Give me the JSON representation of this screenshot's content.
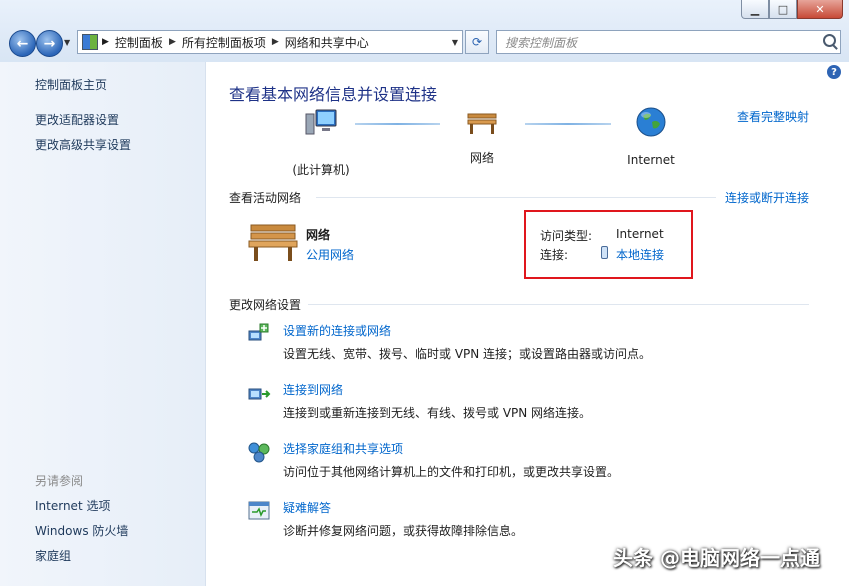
{
  "window": {
    "min_icon": "minimize-icon",
    "max_icon": "maximize-icon",
    "close_icon": "close-icon"
  },
  "address_bar": {
    "crumbs": [
      "控制面板",
      "所有控制面板项",
      "网络和共享中心"
    ]
  },
  "search": {
    "placeholder": "搜索控制面板"
  },
  "sidebar": {
    "top_links": [
      "控制面板主页",
      "更改适配器设置",
      "更改高级共享设置"
    ],
    "see_also_header": "另请参阅",
    "see_also": [
      "Internet 选项",
      "Windows 防火墙",
      "家庭组"
    ]
  },
  "main": {
    "title": "查看基本网络信息并设置连接",
    "full_map_link": "查看完整映射",
    "map": {
      "computer": "(此计算机)",
      "network": "网络",
      "internet": "Internet"
    },
    "active_networks_header": "查看活动网络",
    "connect_disconnect_link": "连接或断开连接",
    "active_network": {
      "name": "网络",
      "type_link": "公用网络",
      "access_type_label": "访问类型:",
      "access_type_value": "Internet",
      "connection_label": "连接:",
      "connection_link": "本地连接"
    },
    "change_settings_header": "更改网络设置",
    "tasks": [
      {
        "title": "设置新的连接或网络",
        "desc": "设置无线、宽带、拨号、临时或 VPN 连接；或设置路由器或访问点。"
      },
      {
        "title": "连接到网络",
        "desc": "连接到或重新连接到无线、有线、拨号或 VPN 网络连接。"
      },
      {
        "title": "选择家庭组和共享选项",
        "desc": "访问位于其他网络计算机上的文件和打印机，或更改共享设置。"
      },
      {
        "title": "疑难解答",
        "desc": "诊断并修复网络问题，或获得故障排除信息。"
      }
    ]
  },
  "watermark": "头条 @电脑网络一点通"
}
